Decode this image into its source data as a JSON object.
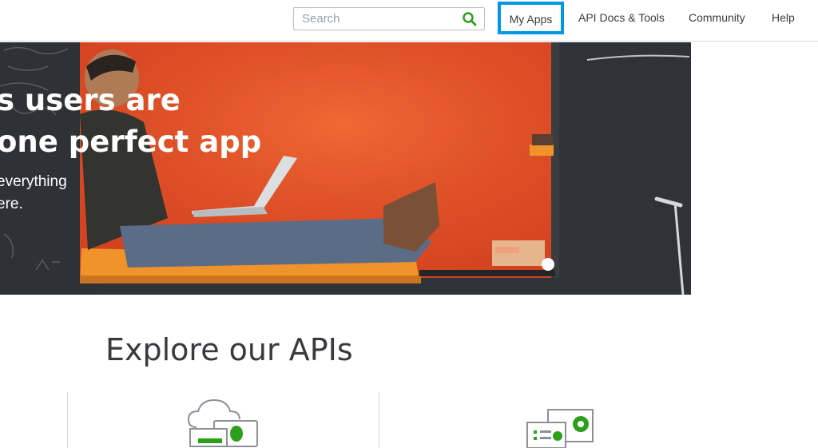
{
  "header": {
    "search": {
      "placeholder": "Search",
      "icon": "search-icon"
    },
    "nav": {
      "my_apps": "My Apps",
      "api_docs": "API Docs & Tools",
      "community": "Community",
      "help": "Help"
    },
    "colors": {
      "focus_outline": "#0097e6",
      "search_icon": "#2ca01c"
    }
  },
  "hero": {
    "title_line1": "s users are",
    "title_line2": "one perfect app",
    "subtitle_line1": "everything",
    "subtitle_line2": "ere.",
    "colors": {
      "orange_wall": "#e8502a",
      "dark_wall": "#2f3238",
      "cushion": "#f0932b"
    }
  },
  "explore": {
    "title": "Explore our APIs",
    "icons": [
      "cloud-api-icon",
      "dashboard-api-icon"
    ],
    "colors": {
      "accent": "#2ca01c",
      "icon_stroke": "#8d9096"
    }
  }
}
